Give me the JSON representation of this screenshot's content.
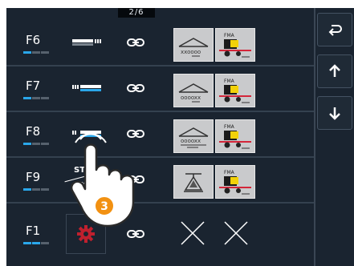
{
  "pager": {
    "text": "2/6"
  },
  "fma_label": "FMA",
  "rows": [
    {
      "key": "F6"
    },
    {
      "key": "F7"
    },
    {
      "key": "F8"
    },
    {
      "key": "F9",
      "start_label": "START",
      "stop_label": "STOP"
    },
    {
      "key": "F1"
    }
  ],
  "step_badge": "3",
  "colors": {
    "background": "#1a2430",
    "accent": "#2aa7ea",
    "gear": "#c0202e",
    "badge": "#f29112"
  }
}
